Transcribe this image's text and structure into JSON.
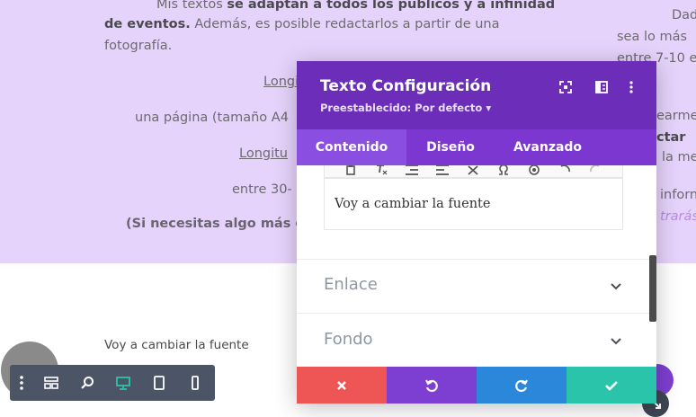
{
  "background_page": {
    "lines": [
      {
        "id": "l1",
        "text_pre": "Mis textos ",
        "text_bold": "se adaptan a todos los públicos y a infinidad",
        "text_post": ""
      },
      {
        "id": "l2",
        "text_pre": "",
        "text_bold": "de eventos.",
        "text_post": " Además, es posible redactarlos a partir de una"
      },
      {
        "id": "l3",
        "text": "fotografía."
      },
      {
        "id": "l4",
        "text": "Longi"
      },
      {
        "id": "l5",
        "text": "una página (tamaño A4"
      },
      {
        "id": "l6",
        "text": "Longitu"
      },
      {
        "id": "l7",
        "text": "entre 30-"
      },
      {
        "id": "l8",
        "text": "(Si necesitas algo más e"
      }
    ],
    "right_lines": [
      {
        "id": "r1",
        "text": "Dad"
      },
      {
        "id": "r2",
        "text": "sea lo más"
      },
      {
        "id": "r3",
        "text": "entre 7-10 e"
      },
      {
        "id": "r4",
        "text": "earme"
      },
      {
        "id": "r5",
        "text": "ctar"
      },
      {
        "id": "r6",
        "text": "la me"
      },
      {
        "id": "r7",
        "text": "inforn"
      },
      {
        "id": "r8",
        "text": "trarás"
      }
    ],
    "below_text": "Voy a cambiar la fuente"
  },
  "modal": {
    "title": "Texto Configuración",
    "preset": "Preestablecido: Por defecto ▾",
    "tabs": [
      {
        "label": "Contenido",
        "active": true
      },
      {
        "label": "Diseño",
        "active": false
      },
      {
        "label": "Avanzado",
        "active": false
      }
    ],
    "editor_text": "Voy a cambiar la fuente",
    "sections": [
      {
        "label": "Enlace"
      },
      {
        "label": "Fondo"
      }
    ],
    "icons": {
      "header": [
        "fullscreen-icon",
        "split-view-icon",
        "more-options-icon"
      ],
      "footer": [
        "close-icon",
        "undo-icon",
        "redo-icon",
        "check-icon"
      ]
    }
  },
  "colors": {
    "header_bg": "#6c2eb9",
    "tabs_bg": "#7b37d0",
    "cancel": "#ee5655",
    "undo": "#7d3fd1",
    "redo": "#2b87da",
    "save": "#29c4a9",
    "page_bg": "#e6d3fb"
  }
}
